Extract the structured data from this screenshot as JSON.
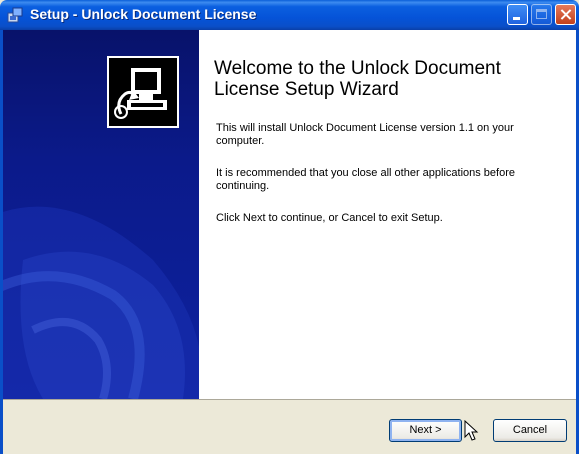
{
  "window": {
    "title": "Setup - Unlock Document License"
  },
  "content": {
    "welcome_title": "Welcome to the Unlock Document License Setup Wizard",
    "paragraph1": "This will install Unlock Document License version 1.1 on your computer.",
    "paragraph2": "It is recommended that you close all other applications before continuing.",
    "paragraph3": "Click Next to continue, or Cancel to exit Setup."
  },
  "buttons": {
    "next_label": "Next >",
    "cancel_label": "Cancel"
  },
  "icons": {
    "title_icon": "setup-installer-icon",
    "logo": "computer-install-icon",
    "cursor": "mouse-pointer-icon"
  },
  "colors": {
    "titlebar": "#0553d8",
    "sidebar": "#0b1a8a",
    "dialog_bg": "#ece9d8",
    "close_button": "#c2401c"
  }
}
